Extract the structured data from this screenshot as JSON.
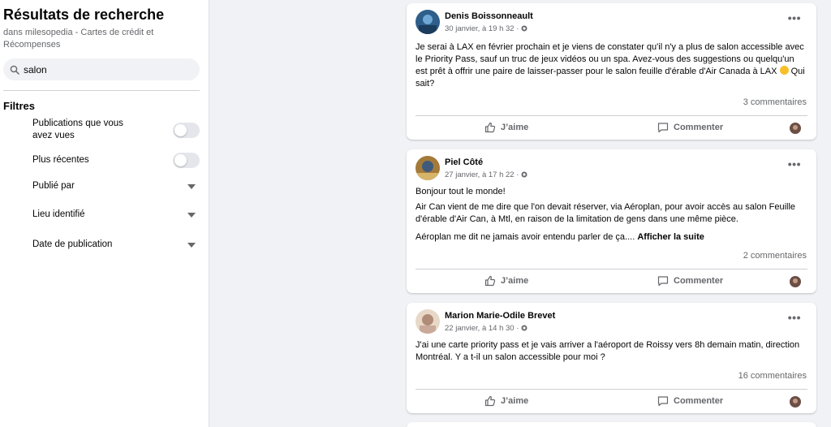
{
  "sidebar": {
    "title": "Résultats de recherche",
    "subtitle": "dans milesopedia - Cartes de crédit et Récompenses",
    "search": {
      "value": "salon",
      "icon": "search-icon"
    },
    "filters_heading": "Filtres",
    "filters": [
      {
        "label": "Publications que vous avez vues",
        "control": "toggle",
        "on": false
      },
      {
        "label": "Plus récentes",
        "control": "toggle",
        "on": false
      },
      {
        "label": "Publié par",
        "control": "dropdown"
      },
      {
        "label": "Lieu identifié",
        "control": "dropdown"
      },
      {
        "label": "Date de publication",
        "control": "dropdown"
      }
    ]
  },
  "actions": {
    "like": "J’aime",
    "comment": "Commenter"
  },
  "colors": {
    "page_bg": "#f0f2f5",
    "card_bg": "#ffffff",
    "secondary_text": "#65676b",
    "toggle_off": "#e4e6eb"
  },
  "posts": [
    {
      "author": "Denis Boissonneault",
      "date": "30 janvier, à 19 h 32 ·",
      "text": "Je serai à LAX en février prochain et je viens de constater qu'il n'y a plus de salon accessible avec le Priority Pass, sauf un truc de jeux vidéos ou un spa. Avez-vous des suggestions ou quelqu'un est prêt à offrir une paire de laisser-passer pour le salon feuille d'érable d'Air Canada à LAX",
      "text_tail": "Qui sait?",
      "comments": "3 commentaires"
    },
    {
      "author": "Piel Côté",
      "date": "27 janvier, à 17 h 22 ·",
      "p1": "Bonjour tout le monde!",
      "p2": "Air Can vient de me dire que l'on devait réserver, via Aéroplan, pour avoir accès au salon Feuille d'érable d'Air Can, à Mtl, en raison de la limitation de gens dans une même pièce.",
      "p3": "Aéroplan me dit ne jamais avoir entendu parler de ça....",
      "see_more": "Afficher la suite",
      "comments": "2 commentaires"
    },
    {
      "author": "Marion Marie-Odile Brevet",
      "date": "22 janvier, à 14 h 30 ·",
      "text": "J'ai une carte priority pass et je vais arriver a l'aéroport de Roissy vers 8h demain matin, direction Montréal. Y a t-il un salon accessible pour moi ?",
      "comments": "16 commentaires"
    }
  ]
}
